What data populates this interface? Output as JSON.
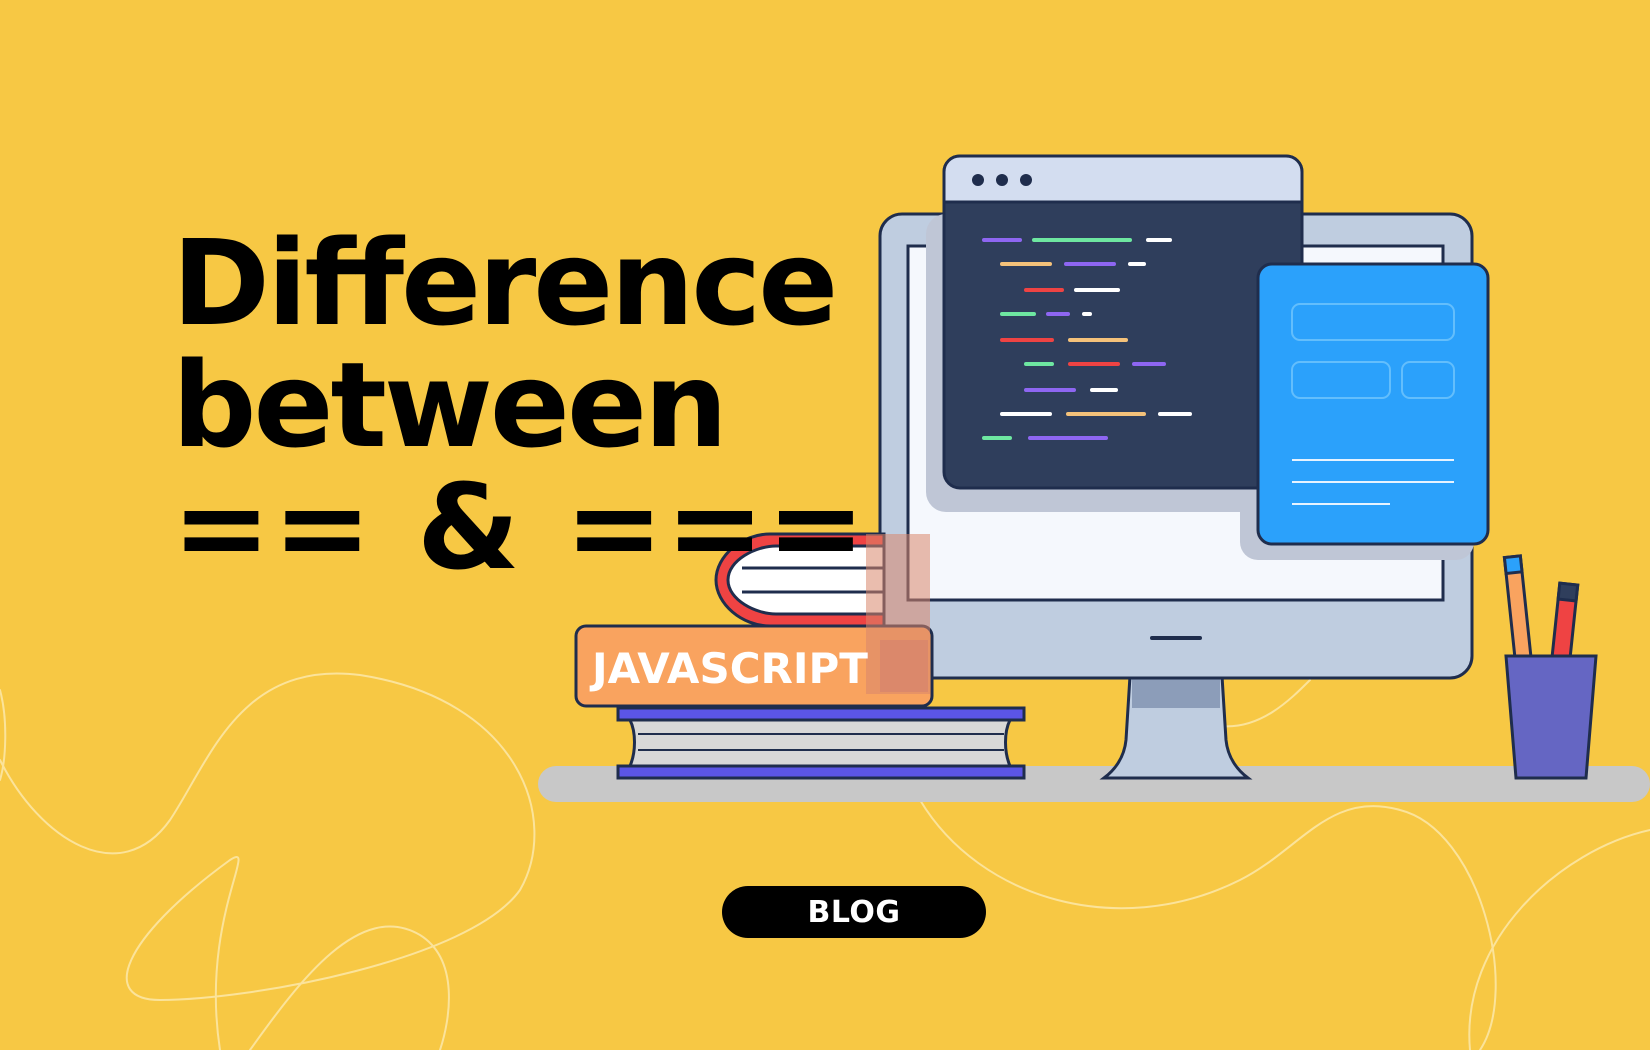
{
  "headline": {
    "line1": "Difference",
    "line2": "between",
    "line3": "== & ==="
  },
  "book": {
    "spine_label": "JAVASCRIPT"
  },
  "badge": {
    "label": "BLOG"
  },
  "colors": {
    "background": "#F7C844",
    "text": "#000000",
    "book_orange": "#F9A35F",
    "book_red": "#EF4343",
    "book_purple": "#5B55E6",
    "window_dark": "#2F3E5C",
    "panel_blue": "#2BA1FB",
    "monitor": "#BFCDE0",
    "cup_purple": "#6566C3",
    "desk": "#C8C8C8"
  },
  "icons": [
    "browser-window-icon",
    "code-editor-icon",
    "form-panel-icon",
    "desktop-monitor-icon",
    "book-stack-icon",
    "pencil-cup-icon"
  ]
}
